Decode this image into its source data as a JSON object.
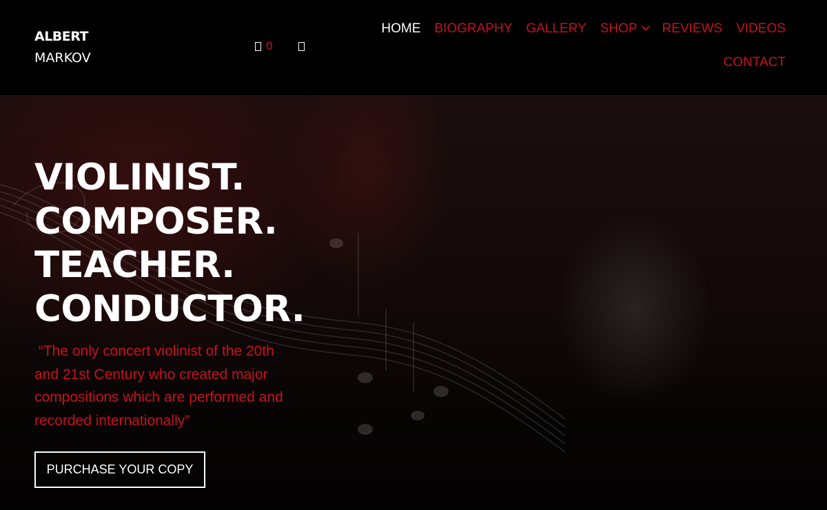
{
  "brand": {
    "first": "ALBERT",
    "last": "MARKOV"
  },
  "header_icons": {
    "cart_count": "0",
    "cart_icon": "cart-icon",
    "search_icon": "search-icon"
  },
  "nav": {
    "row1": [
      {
        "label": "HOME",
        "active": true
      },
      {
        "label": "BIOGRAPHY"
      },
      {
        "label": "GALLERY"
      },
      {
        "label": "SHOP",
        "has_dropdown": true
      },
      {
        "label": "REVIEWS"
      },
      {
        "label": "VIDEOS"
      }
    ],
    "row2": [
      {
        "label": "CONTACT"
      }
    ]
  },
  "hero": {
    "headline": [
      "VIOLINIST.",
      "COMPOSER.",
      "TEACHER.",
      "CONDUCTOR."
    ],
    "quote_lines": [
      " “The only concert violinist of the 20th",
      "and 21st Century who created major",
      "compositions which are performed and",
      "recorded internationally”"
    ],
    "cta_label": "PURCHASE YOUR COPY"
  },
  "colors": {
    "accent": "#c5121e",
    "background": "#000000",
    "text": "#ffffff"
  }
}
